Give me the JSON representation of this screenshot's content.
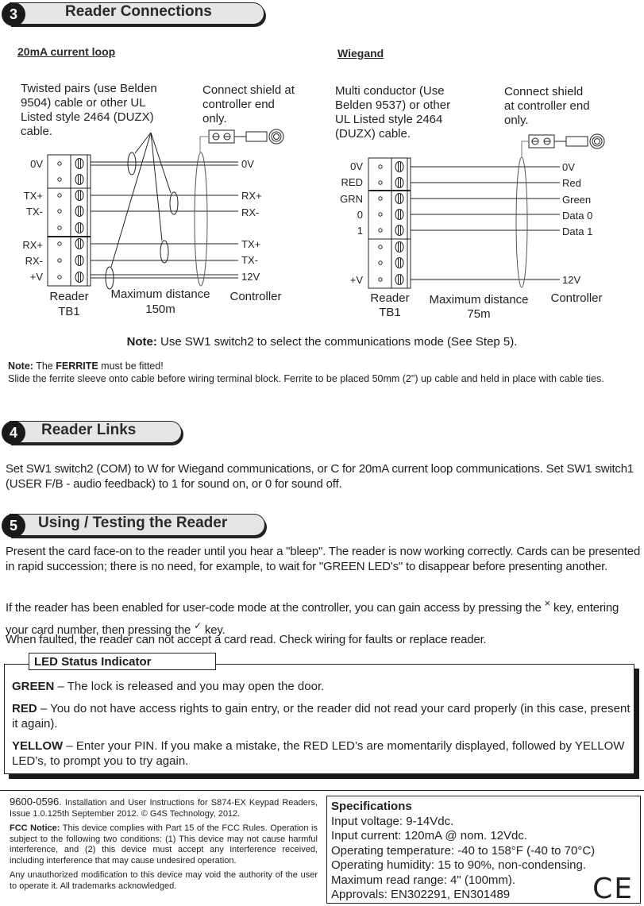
{
  "section3": {
    "number": "3",
    "title": "Reader Connections",
    "current_loop": {
      "subtitle": "20mA current loop",
      "cable_desc": [
        "Twisted pairs (use Belden",
        "9504) cable or other UL",
        "Listed style 2464 (DUZX)",
        "cable."
      ],
      "shield_desc": [
        "Connect shield at",
        "controller end",
        "only."
      ],
      "reader_pins": [
        "0V",
        "TX+",
        "TX-",
        "RX+",
        "RX-",
        "+V"
      ],
      "controller_pins": [
        "0V",
        "RX+",
        "RX-",
        "TX+",
        "TX-",
        "12V"
      ],
      "reader_label": [
        "Reader",
        "TB1"
      ],
      "distance_label": [
        "Maximum distance",
        "150m"
      ],
      "controller_label": "Controller"
    },
    "wiegand": {
      "subtitle": "Wiegand",
      "cable_desc": [
        "Multi conductor (Use",
        "Belden 9537) or other",
        "UL Listed style 2464",
        "(DUZX) cable."
      ],
      "shield_desc": [
        "Connect shield",
        "at controller end",
        "only."
      ],
      "reader_pins": [
        "0V",
        "RED",
        "GRN",
        "0",
        "1",
        "+V"
      ],
      "controller_pins": [
        "0V",
        "Red",
        "Green",
        "Data 0",
        "Data 1",
        "12V"
      ],
      "reader_label": [
        "Reader",
        "TB1"
      ],
      "distance_label": [
        "Maximum distance",
        "75m"
      ],
      "controller_label": "Controller"
    },
    "note_mode": {
      "bold": "Note:",
      "text": " Use SW1 switch2 to select the communications mode (See Step 5)."
    },
    "note_ferrite": {
      "bold1": "Note:",
      "text1": " The ",
      "bold2": "FERRITE",
      "text2": " must be fitted!",
      "line2": "Slide the ferrite sleeve onto cable before wiring terminal block.  Ferrite to be placed 50mm (2\") up cable and held in place with cable ties."
    }
  },
  "section4": {
    "number": "4",
    "title": "Reader Links",
    "body": "Set SW1 switch2 (COM) to W for Wiegand communications, or C for 20mA current loop communications. Set SW1 switch1 (USER F/B - audio feedback) to 1 for sound on, or 0 for sound off."
  },
  "section5": {
    "number": "5",
    "title": "Using / Testing the Reader",
    "p1": "Present the card face-on to the reader until you hear a \"bleep\".  The reader is now working correctly.  Cards can be presented in rapid succession; there is no need, for example, to wait for \"GREEN LED's\" to disappear before presenting another.",
    "p2_a": "If the reader has been enabled for user-code mode at the controller, you can gain access by pressing the ",
    "p2_x": "×",
    "p2_b": " key, entering your card number, then pressing the ",
    "p2_check": "✓",
    "p2_c": " key.",
    "p3": "When faulted, the reader can not accept a card read.  Check wiring for faults or replace reader."
  },
  "led_status": {
    "title": "LED Status Indicator",
    "items": [
      {
        "color": "GREEN",
        "text": " – The lock is released and you may open the door."
      },
      {
        "color": "RED",
        "text": " – You do not have access rights to gain entry, or the reader did not read your card properly (in this case, present it again)."
      },
      {
        "color": "YELLOW",
        "text": " – Enter your PIN. If you make a mistake, the RED LED’s are momentarily displayed, followed by YELLOW LED’s, to prompt you to try again."
      }
    ]
  },
  "footer": {
    "doc_number": "9600-0596.",
    "doc_info": " Installation and User Instructions for S874-EX Keypad Readers, Issue 1.0.125th September 2012. © G4S Technology, 2012.",
    "fcc_bold": "FCC Notice:",
    "fcc_text": " This device complies with Part 15 of the FCC Rules. Operation is subject to the following two conditions: (1) This device may not cause harmful interference, and (2) this device must accept any interference received, including interference that may cause undesired operation.",
    "modification": "Any unauthorized modification to this device may void the authority of the user to operate it. All trademarks acknowledged."
  },
  "specifications": {
    "title": "Specifications",
    "lines": [
      "Input voltage: 9-14Vdc.",
      "Input current:  120mA @ nom. 12Vdc.",
      "Operating temperature: -40 to 158°F (-40 to 70°C)",
      "Operating humidity: 15 to 90%, non-condensing.",
      "Maximum read range: 4\" (100mm).",
      "Approvals: EN302291, EN301489"
    ],
    "ce_mark": "CE"
  }
}
